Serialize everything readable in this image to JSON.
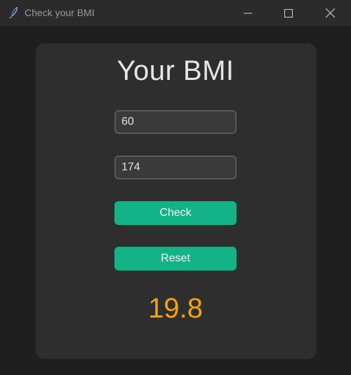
{
  "window": {
    "title": "Check your BMI",
    "controls": {
      "minimize": "minimize-icon",
      "maximize": "maximize-icon",
      "close": "close-icon"
    }
  },
  "form": {
    "heading": "Your BMI",
    "weight_value": "60",
    "height_value": "174",
    "check_label": "Check",
    "reset_label": "Reset",
    "result": "19.8"
  },
  "colors": {
    "background": "#1f1f1f",
    "card": "#2e2e2e",
    "accent": "#12b386",
    "result": "#f5a30a"
  }
}
